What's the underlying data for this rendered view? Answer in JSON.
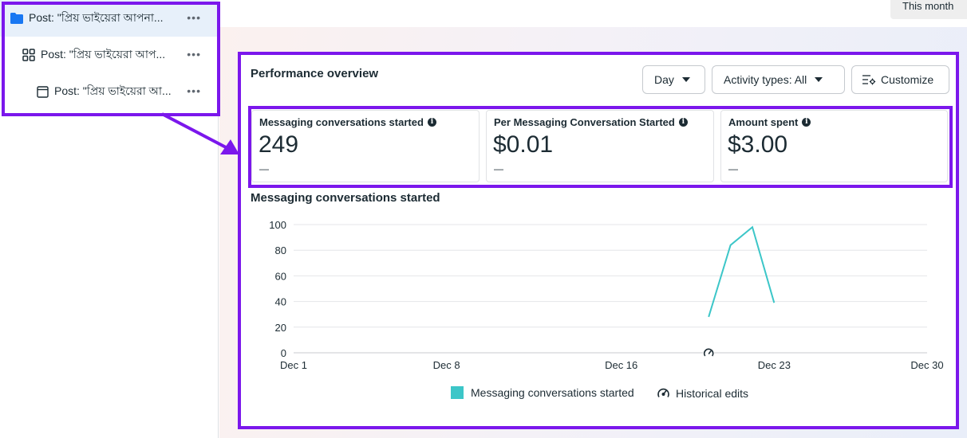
{
  "tree": {
    "items": [
      {
        "label": "Post: \"প্রিয় ভাইয়েরা আপনা...",
        "icon": "folder-icon",
        "more": "•••"
      },
      {
        "label": "Post: \"প্রিয় ভাইয়েরা আপ...",
        "icon": "grid-icon",
        "more": "•••"
      },
      {
        "label": "Post: \"প্রিয় ভাইয়েরা আ...",
        "icon": "ad-frame-icon",
        "more": "•••"
      }
    ]
  },
  "header": {
    "date_range": "This month"
  },
  "performance": {
    "title": "Performance overview",
    "controls": {
      "day": "Day",
      "activity": "Activity types: All",
      "customize": "Customize"
    },
    "metrics": [
      {
        "label": "Messaging conversations started",
        "value": "249",
        "change": "—"
      },
      {
        "label": "Per Messaging Conversation Started",
        "value": "$0.01",
        "change": "—"
      },
      {
        "label": "Amount spent",
        "value": "$3.00",
        "change": "—"
      }
    ],
    "chart_title": "Messaging conversations started",
    "legend": {
      "series": "Messaging conversations started",
      "historical": "Historical edits"
    }
  },
  "chart_data": {
    "type": "line",
    "title": "Messaging conversations started",
    "xlabel": "",
    "ylabel": "",
    "ylim": [
      0,
      100
    ],
    "yticks": [
      0,
      20,
      40,
      60,
      80,
      100
    ],
    "xlim": [
      1,
      30
    ],
    "xticks": [
      {
        "day": 1,
        "label": "Dec 1"
      },
      {
        "day": 8,
        "label": "Dec 8"
      },
      {
        "day": 16,
        "label": "Dec 16"
      },
      {
        "day": 23,
        "label": "Dec 23"
      },
      {
        "day": 30,
        "label": "Dec 30"
      }
    ],
    "series": [
      {
        "name": "Messaging conversations started",
        "color": "#3cc6c8",
        "points": [
          {
            "day": 20,
            "value": 28
          },
          {
            "day": 21,
            "value": 84
          },
          {
            "day": 22,
            "value": 98
          },
          {
            "day": 23,
            "value": 39
          }
        ]
      }
    ],
    "markers": [
      {
        "type": "historical-edit",
        "day": 20
      }
    ],
    "grid": true
  },
  "colors": {
    "accent": "#7b17ec",
    "series": "#3cc6c8",
    "selected_row": "#e7f0fa"
  }
}
